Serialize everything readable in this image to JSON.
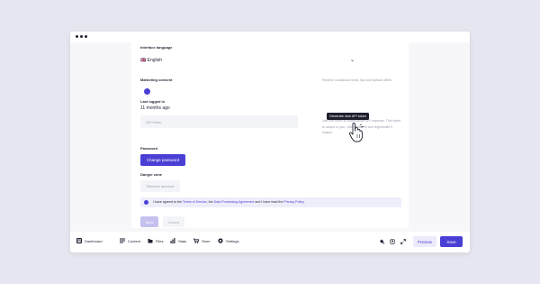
{
  "settings": {
    "language_label": "Interface language",
    "language_value": "🇬🇧 English",
    "marketing_label": "Marketing consent",
    "marketing_hint": "Receive occasional news, tips and special offers",
    "marketing_enabled": true,
    "last_logged_label": "Last logged in",
    "last_logged_value": "11 months ago",
    "api_placeholder": "API token",
    "api_tooltip": "Generate new API token",
    "api_hint": "Use this token to authenticate API requests. This token is unique to you - keep it secret and regenerate if leaked.",
    "password_label": "Password",
    "change_password": "Change password",
    "danger_label": "Danger zone",
    "remove_account": "Remove account",
    "consent_pre": "I have agreed to the ",
    "consent_tos": "Terms of Service",
    "consent_mid1": ", the ",
    "consent_dpa": "Data Processing Agreement",
    "consent_mid2": " and I have read the ",
    "consent_privacy": "Privacy Policy",
    "consent_end": ".",
    "save": "Save",
    "cancel": "Cancel"
  },
  "bottombar": {
    "nav": [
      {
        "label": "Dashboard",
        "icon": "dashboard-icon"
      },
      {
        "label": "Content",
        "icon": "content-icon"
      },
      {
        "label": "Files",
        "icon": "files-icon"
      },
      {
        "label": "Stats",
        "icon": "stats-icon"
      },
      {
        "label": "Store",
        "icon": "store-icon"
      },
      {
        "label": "Settings",
        "icon": "settings-icon"
      }
    ],
    "preview": "Preview",
    "save": "Save"
  },
  "colors": {
    "accent": "#4a3fd4",
    "background": "#e5e6ef",
    "tooltip": "#1e1f2b"
  }
}
